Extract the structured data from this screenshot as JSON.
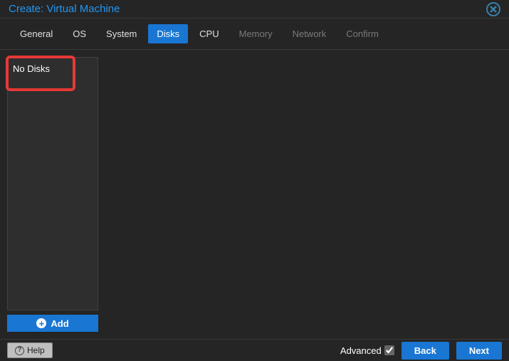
{
  "window": {
    "title": "Create: Virtual Machine"
  },
  "tabs": [
    {
      "label": "General",
      "state": "enabled"
    },
    {
      "label": "OS",
      "state": "enabled"
    },
    {
      "label": "System",
      "state": "enabled"
    },
    {
      "label": "Disks",
      "state": "active"
    },
    {
      "label": "CPU",
      "state": "enabled"
    },
    {
      "label": "Memory",
      "state": "disabled"
    },
    {
      "label": "Network",
      "state": "disabled"
    },
    {
      "label": "Confirm",
      "state": "disabled"
    }
  ],
  "disks": {
    "empty_label": "No Disks",
    "add_label": "Add"
  },
  "footer": {
    "help_label": "Help",
    "advanced_label": "Advanced",
    "advanced_checked": true,
    "back_label": "Back",
    "next_label": "Next"
  },
  "colors": {
    "accent": "#1976d2",
    "title": "#2196f3",
    "highlight": "#e63935",
    "bg": "#252525"
  }
}
